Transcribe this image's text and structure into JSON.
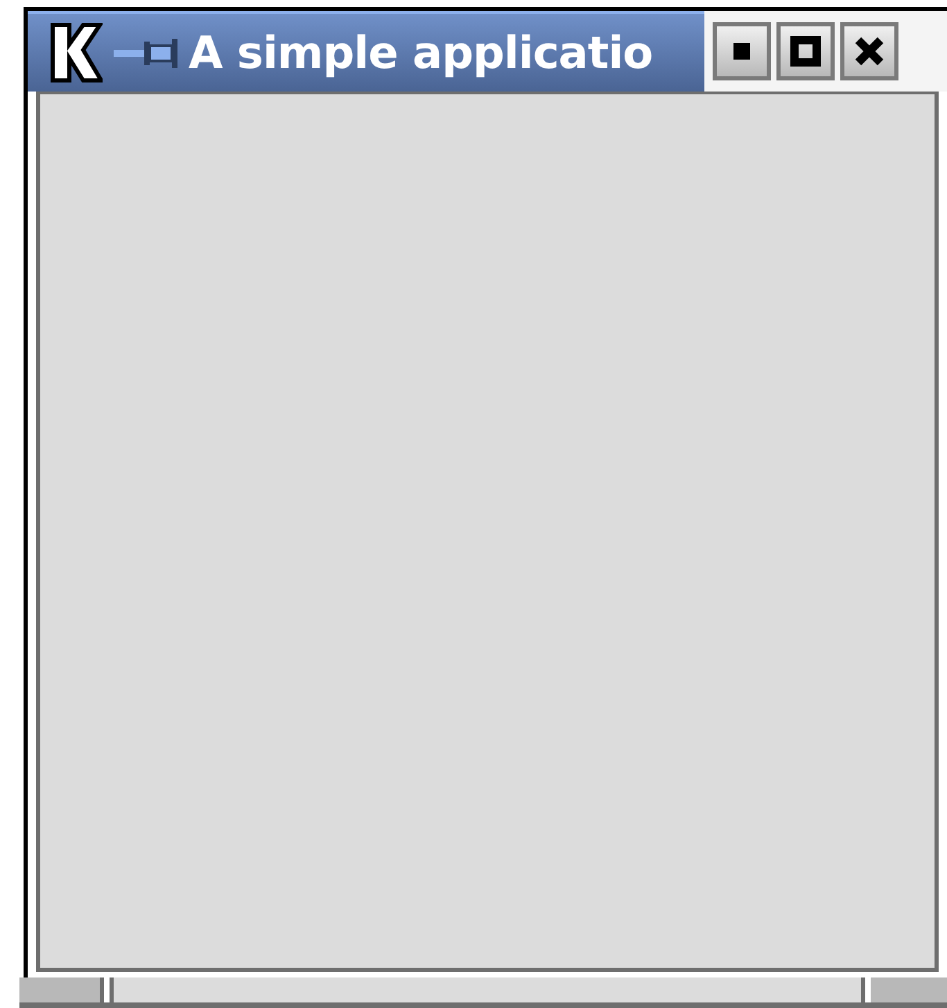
{
  "window": {
    "title": "A simple applicatio"
  }
}
